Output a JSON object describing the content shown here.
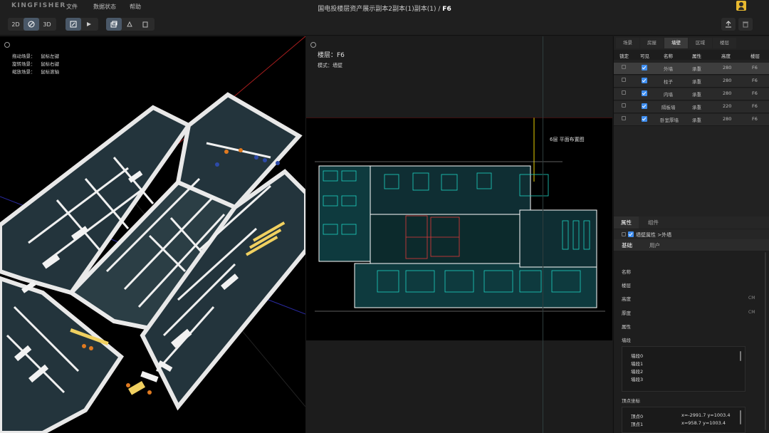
{
  "app": {
    "logo": "KINGFISHER",
    "menu": [
      "文件",
      "数据状态",
      "帮助"
    ],
    "title_path": "国电投楼层资产展示副本2副本(1)副本(1)",
    "title_sep": "/",
    "title_current": "F6"
  },
  "toolbar": {
    "view_modes": [
      "2D",
      "",
      "3D"
    ],
    "icons": [
      "orbit-mode-icon",
      "edit-icon",
      "play-icon",
      "layers-icon",
      "copy-icon",
      "paste-icon",
      "upload-icon",
      "delete-icon"
    ]
  },
  "view3d": {
    "hints": [
      {
        "label": "拖动场景：",
        "value": "鼠标左键"
      },
      {
        "label": "旋转场景：",
        "value": "鼠标右键"
      },
      {
        "label": "缩放场景：",
        "value": "鼠标滚轴"
      }
    ]
  },
  "view2d": {
    "floor_label": "楼层：F6",
    "mode_label": "模式：墙壁",
    "plan_title": "6层 平面布置图"
  },
  "panel": {
    "tabs": [
      "场景",
      "房屋",
      "墙壁",
      "区域",
      "楼层"
    ],
    "active_tab": "墙壁",
    "columns": [
      "锁定",
      "可见",
      "名称",
      "属性",
      "高度",
      "楼层"
    ],
    "rows": [
      {
        "name": "外墙",
        "attr": "承重",
        "height": "280",
        "floor": "F6"
      },
      {
        "name": "柱子",
        "attr": "承重",
        "height": "280",
        "floor": "F6"
      },
      {
        "name": "内墙",
        "attr": "承重",
        "height": "280",
        "floor": "F6"
      },
      {
        "name": "隔板墙",
        "attr": "承重",
        "height": "220",
        "floor": "F6"
      },
      {
        "name": "卧室厚墙",
        "attr": "承重",
        "height": "280",
        "floor": "F6"
      }
    ],
    "attr_tabs": [
      "属性",
      "组件"
    ],
    "attr_header": "墙壁属性 >外墙",
    "sub_tabs": [
      "基础",
      "用户"
    ],
    "fields": [
      {
        "label": "名称",
        "unit": ""
      },
      {
        "label": "楼层",
        "unit": ""
      },
      {
        "label": "高度",
        "unit": "CM"
      },
      {
        "label": "厚度",
        "unit": "CM"
      },
      {
        "label": "属性",
        "unit": ""
      }
    ],
    "segments_label": "墙段",
    "segments": [
      "墙段0",
      "墙段1",
      "墙段2",
      "墙段3"
    ],
    "vertices_label": "顶点坐标",
    "vertices": [
      {
        "name": "顶点0",
        "coords": "x=-2991.7  y=1003.4"
      },
      {
        "name": "顶点1",
        "coords": "x=958.7  y=1003.4"
      }
    ]
  }
}
